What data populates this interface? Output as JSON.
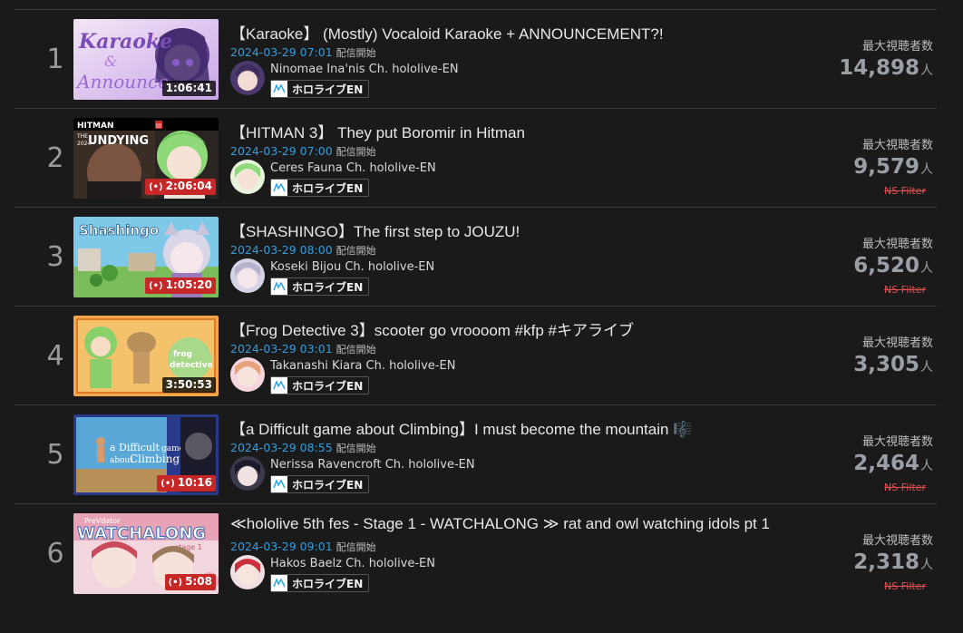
{
  "stat_label": "最大視聴者数",
  "unit": "人",
  "date_suffix": "配信開始",
  "agency": "ホロライブEN",
  "ns_filter": "NS Filter",
  "rows": [
    {
      "rank": "1",
      "title": "【Karaoke】 (Mostly) Vocaloid Karaoke + ANNOUNCEMENT?!",
      "date": "2024-03-29 07:01",
      "channel": "Ninomae Ina'nis Ch. hololive-EN",
      "duration": "1:06:41",
      "live": false,
      "viewers": "14,898",
      "ns_filter": false,
      "thumb_text": [
        "Karaoke",
        "&",
        "Announce"
      ]
    },
    {
      "rank": "2",
      "title": "【HITMAN 3】 They put Boromir in Hitman",
      "date": "2024-03-29 07:00",
      "channel": "Ceres Fauna Ch. hololive-EN",
      "duration": "2:06:04",
      "live": true,
      "viewers": "9,579",
      "ns_filter": true,
      "thumb_text": [
        "HITMAN",
        "III",
        "THE",
        "UNDYING",
        "2024"
      ]
    },
    {
      "rank": "3",
      "title": "【SHASHINGO】The first step to JOUZU!",
      "date": "2024-03-29 08:00",
      "channel": "Koseki Bijou Ch. hololive-EN",
      "duration": "1:05:20",
      "live": true,
      "viewers": "6,520",
      "ns_filter": true,
      "thumb_text": [
        "Shashingo"
      ]
    },
    {
      "rank": "4",
      "title": "【Frog Detective 3】scooter go vroooom #kfp #キアライブ",
      "date": "2024-03-29 03:01",
      "channel": "Takanashi Kiara Ch. hololive-EN",
      "duration": "3:50:53",
      "live": false,
      "viewers": "3,305",
      "ns_filter": false,
      "thumb_text": [
        "frog",
        "detective"
      ]
    },
    {
      "rank": "5",
      "title": "【a Difficult game about Climbing】I must become the mountain 🎼",
      "date": "2024-03-29 08:55",
      "channel": "Nerissa Ravencroft Ch. hololive-EN",
      "duration": "10:16",
      "live": true,
      "viewers": "2,464",
      "ns_filter": true,
      "thumb_text": [
        "a Difficult",
        "game",
        "about",
        "Climbing"
      ]
    },
    {
      "rank": "6",
      "title": "≪hololive 5th fes - Stage 1 - WATCHALONG ≫ rat and owl watching idols pt 1",
      "date": "2024-03-29 09:01",
      "channel": "Hakos Baelz Ch. hololive-EN",
      "duration": "5:08",
      "live": true,
      "viewers": "2,318",
      "ns_filter": true,
      "thumb_text": [
        "PreVdator",
        "WATCHALONG",
        "stage 1"
      ]
    }
  ]
}
